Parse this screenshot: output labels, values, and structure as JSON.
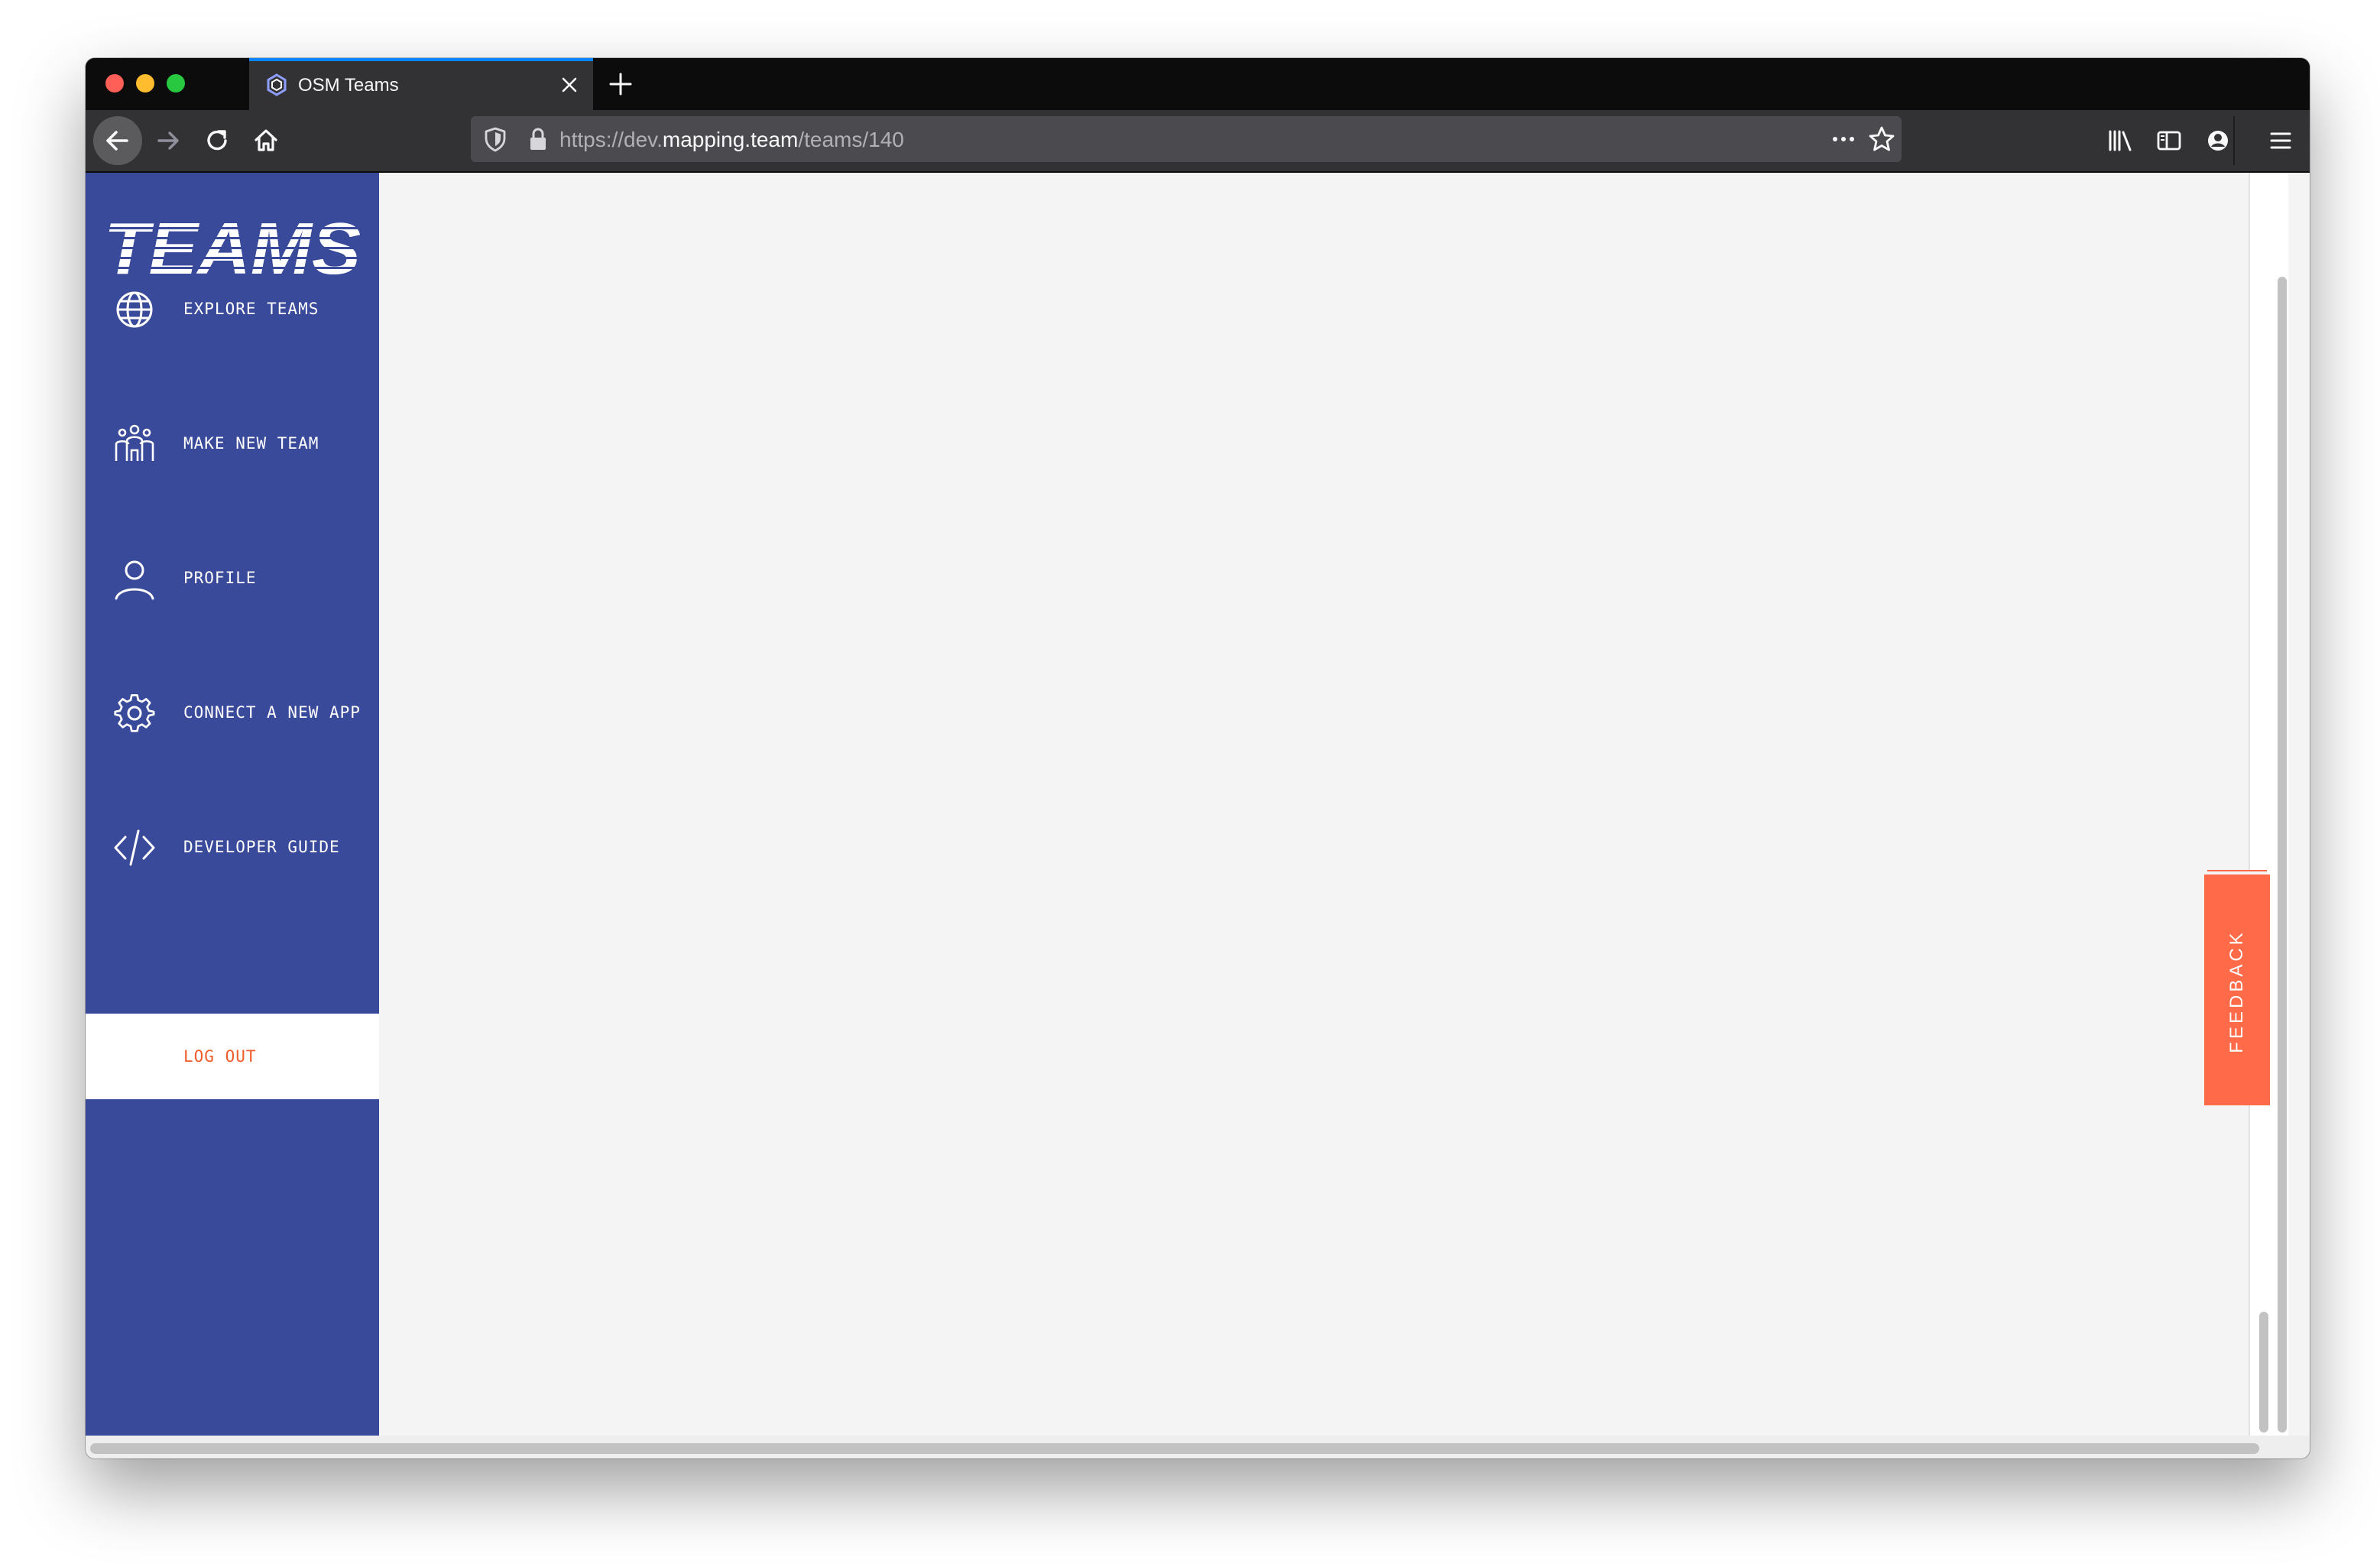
{
  "browser": {
    "tab_title": "OSM Teams",
    "url": {
      "prefix": "https://dev.",
      "domain": "mapping.team",
      "path": "/teams/140"
    }
  },
  "sidebar": {
    "logo_text": "TEAMS",
    "items": [
      {
        "label": "EXPLORE TEAMS",
        "icon": "globe-icon"
      },
      {
        "label": "MAKE NEW TEAM",
        "icon": "people-icon"
      },
      {
        "label": "PROFILE",
        "icon": "user-icon"
      },
      {
        "label": "CONNECT A NEW APP",
        "icon": "gear-icon"
      },
      {
        "label": "DEVELOPER GUIDE",
        "icon": "code-icon"
      }
    ],
    "logout_label": "LOG OUT"
  },
  "feedback": {
    "label": "FEEDBACK"
  },
  "colors": {
    "sidebar_bg": "#3a4a9a",
    "logout_text": "#ef5b2b",
    "feedback_bg": "#ff6a48",
    "content_bg": "#f4f4f4"
  }
}
